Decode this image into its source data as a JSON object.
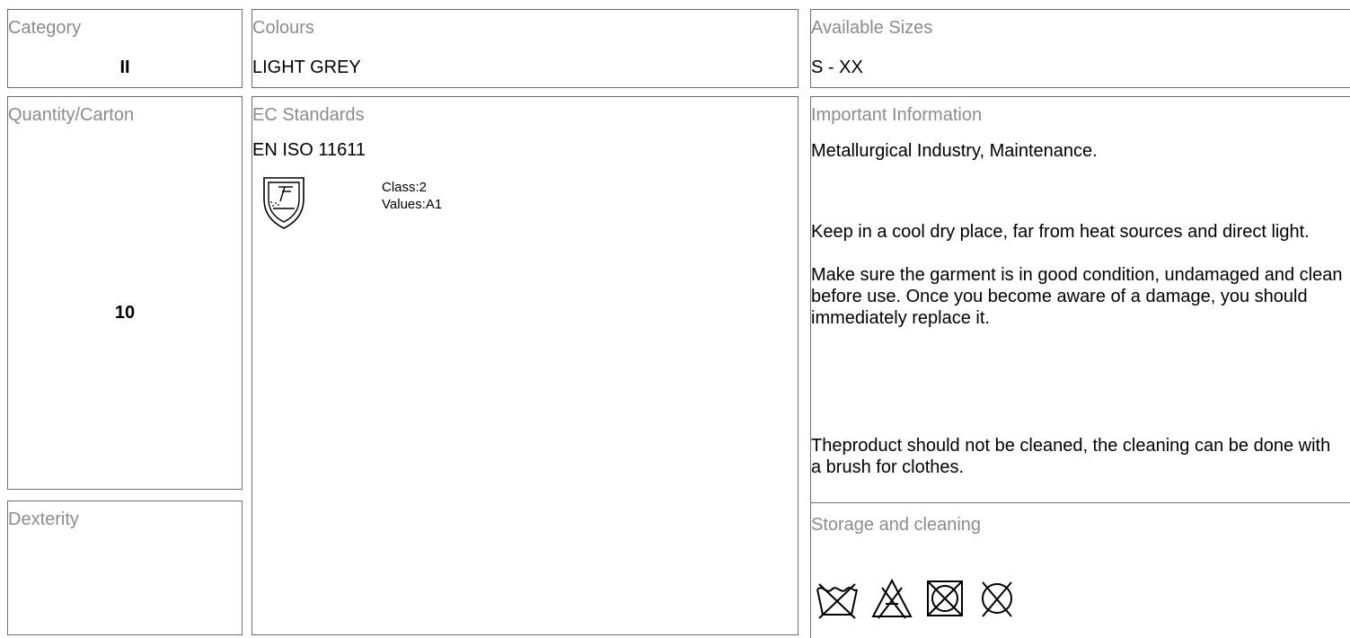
{
  "category": {
    "label": "Category",
    "value": "II"
  },
  "colours": {
    "label": "Colours",
    "value": "LIGHT GREY"
  },
  "sizes": {
    "label": "Available Sizes",
    "value": "S - XX"
  },
  "quantity": {
    "label": "Quantity/Carton",
    "value": "10"
  },
  "standards": {
    "label": "EC Standards",
    "value": "EN ISO 11611",
    "pictogram": "welding-protection-icon",
    "class_text": "Class:2",
    "values_text": "Values:A1"
  },
  "important": {
    "label": "Important Information",
    "line1": "Metallurgical Industry, Maintenance.",
    "para2": "Keep in a cool dry place, far from heat sources and direct light.",
    "para3": "Make sure the garment is in good condition, undamaged and clean before use. Once you become aware of a damage, you should immediately replace it.",
    "para4": "Theproduct should not be cleaned, the cleaning can be done with a brush for clothes."
  },
  "dexterity": {
    "label": "Dexterity",
    "value": ""
  },
  "storage": {
    "label": "Storage and cleaning",
    "care_icons": [
      "do-not-wash-icon",
      "do-not-bleach-icon",
      "do-not-tumble-dry-icon",
      "do-not-dry-clean-icon"
    ]
  }
}
